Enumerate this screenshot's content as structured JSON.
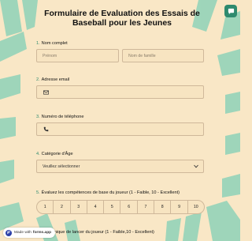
{
  "form": {
    "title": "Formulaire de Evaluation des Essais de Baseball pour les Jeunes"
  },
  "questions": [
    {
      "number": "1.",
      "label": "Nom complet"
    },
    {
      "number": "2.",
      "label": "Adresse email"
    },
    {
      "number": "3.",
      "label": "Numéro de téléphone"
    },
    {
      "number": "4.",
      "label": "Catégorie d'Âge"
    },
    {
      "number": "5.",
      "label": "Évaluez les compétences de base du joueur (1 - Faible, 10 - Excellent)"
    },
    {
      "number": "6.",
      "label": "la technique de lancer du joueur (1 - Faible,10 - Excellent)"
    }
  ],
  "fields": {
    "first_name_placeholder": "Prénom",
    "last_name_placeholder": "Nom de famille",
    "age_select_value": "Veuillez sélectionner"
  },
  "scale": [
    "1",
    "2",
    "3",
    "4",
    "5",
    "6",
    "7",
    "8",
    "9",
    "10"
  ],
  "badge": {
    "prefix": "Made with",
    "brand": "forms.app"
  },
  "icons": {
    "corner": "chat-icon",
    "email": "envelope-icon",
    "phone": "phone-icon",
    "select": "chevron-down-icon",
    "badge_logo": "forms-app-logo"
  },
  "colors": {
    "background": "#f9e7c6",
    "stripes": "#8fd2b8",
    "accent": "#2e8a6e",
    "field_border": "#cfb89a"
  }
}
